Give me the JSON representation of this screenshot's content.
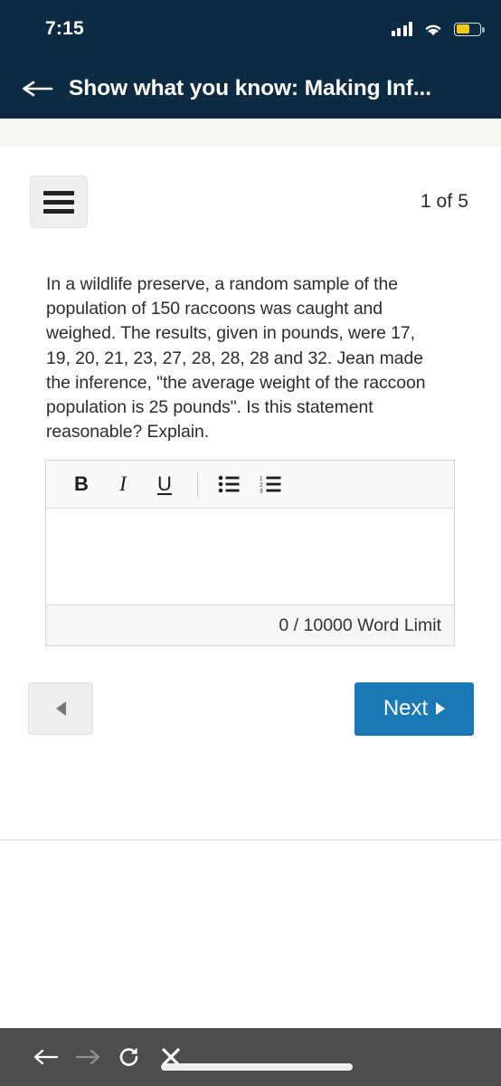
{
  "status_bar": {
    "time": "7:15",
    "signal_icon": "cellular-signal-icon",
    "wifi_icon": "wifi-icon",
    "battery_icon": "battery-icon",
    "battery_level_percent": 58,
    "battery_color": "#f5cc14"
  },
  "header": {
    "back_icon": "back-arrow-icon",
    "title": "Show what you know:  Making Inf...",
    "background_color": "#0d2b42"
  },
  "toolbar": {
    "menu_icon": "hamburger-menu-icon",
    "page_counter": "1 of 5"
  },
  "question": {
    "text": "In a wildlife preserve, a random sample of the population of 150 raccoons was caught and weighed.  The results, given in pounds, were 17, 19, 20, 21, 23, 27, 28, 28, 28 and 32.  Jean made the inference, \"the average weight of the raccoon population is 25 pounds\".  Is this statement reasonable?  Explain."
  },
  "editor": {
    "bold_label": "B",
    "italic_label": "I",
    "underline_label": "U",
    "bullet_list_icon": "bullet-list-icon",
    "numbered_list_icon": "numbered-list-icon",
    "body_value": "",
    "body_placeholder": "",
    "word_limit_text": "0 / 10000 Word Limit"
  },
  "navigation": {
    "prev_icon": "triangle-left-icon",
    "next_label": "Next",
    "next_icon": "triangle-right-icon",
    "next_color": "#1a78b5"
  },
  "browser_bar": {
    "back_icon": "browser-back-arrow-icon",
    "forward_icon": "browser-forward-arrow-icon",
    "reload_icon": "reload-icon",
    "stop_icon": "close-x-icon",
    "url_value": "",
    "background_color": "#4d4d4d"
  }
}
